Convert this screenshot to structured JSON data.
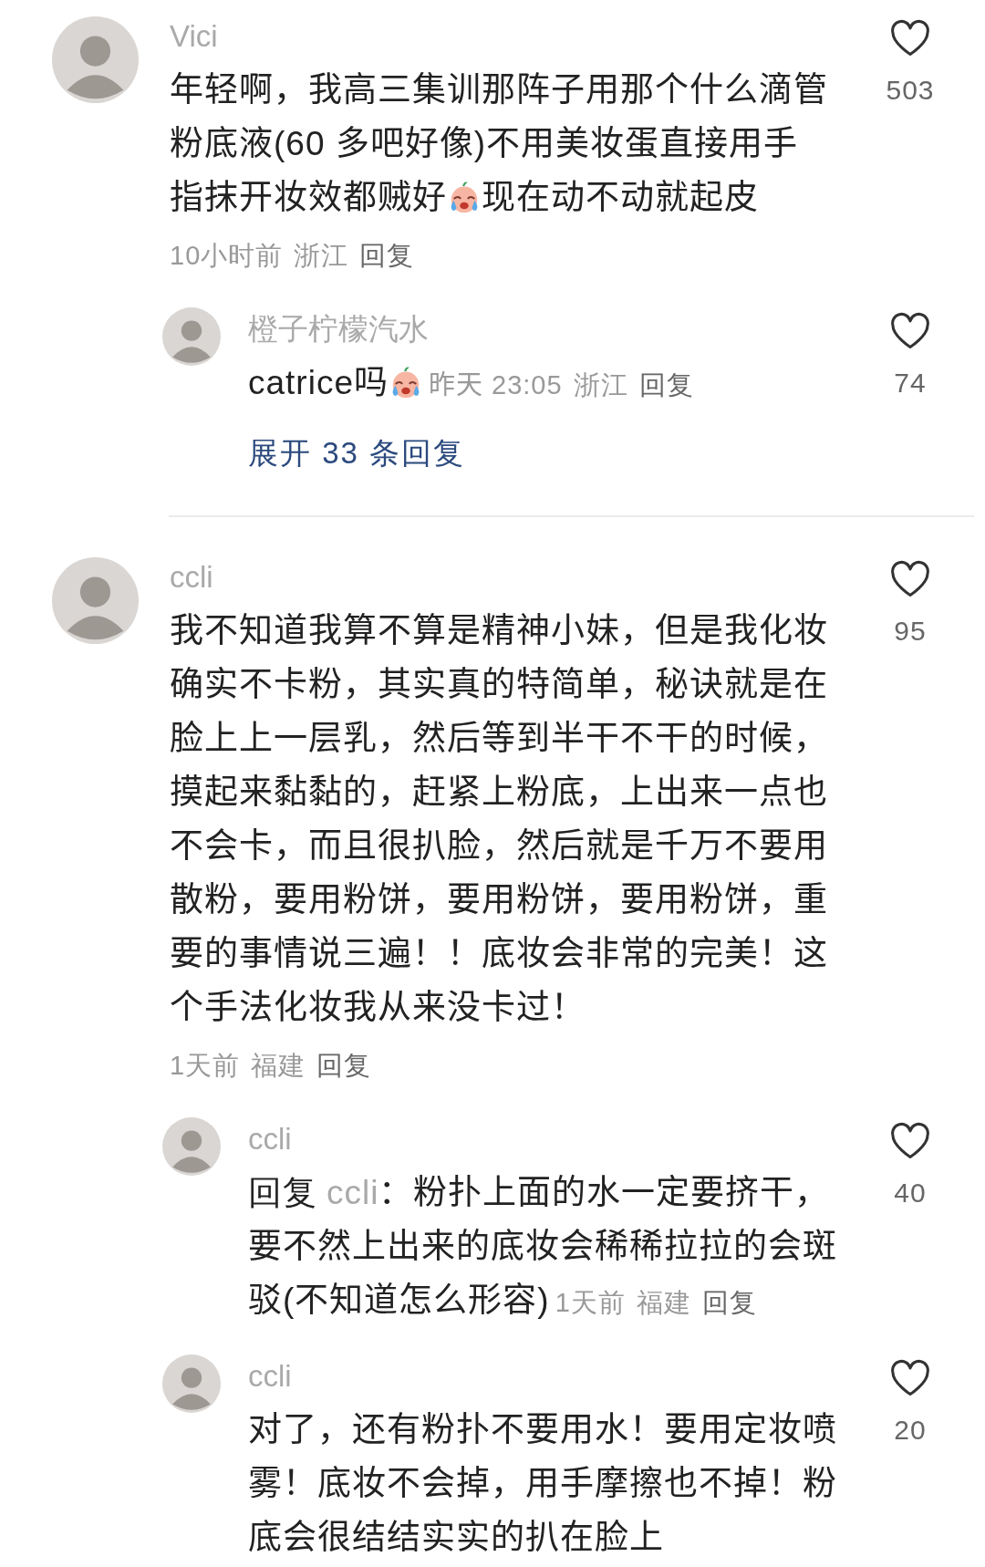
{
  "threads": [
    {
      "comment": {
        "user": "Vici",
        "body": [
          {
            "kind": "text",
            "text": "年轻啊，我高三集训那阵子用那个什么滴管粉底液(60 多吧好像)不用美妆蛋直接用手指抹开妆效都贼好"
          },
          {
            "kind": "emoji"
          },
          {
            "kind": "text",
            "text": "现在动不动就起皮"
          }
        ],
        "time": "10小时前",
        "location": "浙江",
        "reply_button": "回复",
        "likes": "503"
      },
      "replies": [
        {
          "user": "橙子柠檬汽水",
          "body": [
            {
              "kind": "text",
              "text": "catrice吗"
            },
            {
              "kind": "emoji"
            }
          ],
          "time": "昨天 23:05",
          "location": "浙江",
          "reply_button": "回复",
          "likes": "74"
        }
      ],
      "expand_link": "展开 33 条回复"
    },
    {
      "comment": {
        "user": "ccli",
        "body": [
          {
            "kind": "text",
            "text": "我不知道我算不算是精神小妹，但是我化妆确实不卡粉，其实真的特简单，秘诀就是在脸上上一层乳，然后等到半干不干的时候，摸起来黏黏的，赶紧上粉底，上出来一点也不会卡，而且很扒脸，然后就是千万不要用散粉，要用粉饼，要用粉饼，要用粉饼，重要的事情说三遍！！底妆会非常的完美！这个手法化妆我从来没卡过！"
          }
        ],
        "time": "1天前",
        "location": "福建",
        "reply_button": "回复",
        "likes": "95"
      },
      "replies": [
        {
          "user": "ccli",
          "body": [
            {
              "kind": "text",
              "text": "回复"
            },
            {
              "kind": "mention",
              "text": "ccli"
            },
            {
              "kind": "text",
              "text": "：粉扑上面的水一定要挤干，要不然上出来的底妆会稀稀拉拉的会斑驳(不知道怎么形容)"
            }
          ],
          "time": "1天前",
          "location": "福建",
          "reply_button": "回复",
          "likes": "40"
        },
        {
          "user": "ccli",
          "body": [
            {
              "kind": "text",
              "text": "对了，还有粉扑不要用水！要用定妆喷雾！底妆不会掉，用手摩擦也不掉！粉底会很结结实实的扒在脸上"
            }
          ],
          "likes": "20"
        }
      ]
    }
  ]
}
